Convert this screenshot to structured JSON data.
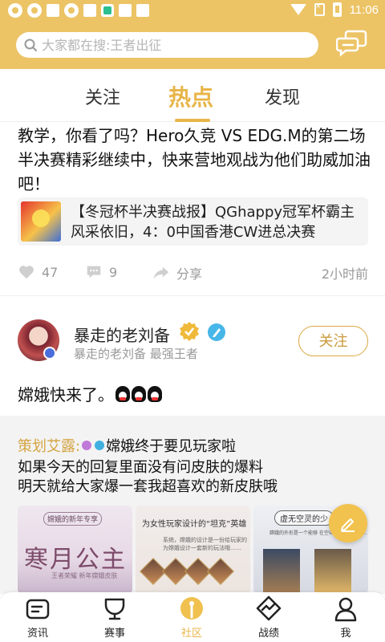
{
  "status_bar": {
    "time": "11:06"
  },
  "search": {
    "placeholder": "大家都在搜:王者出征"
  },
  "tabs": [
    {
      "label": "关注"
    },
    {
      "label": "热点",
      "selected": true
    },
    {
      "label": "发现"
    }
  ],
  "post1": {
    "text": "教学，你看了吗？Hero久竞 VS EDG.M的第二场半决赛精彩继续中，快来营地观战为他们助威加油吧！",
    "link_card": {
      "title": "【冬冠杯半决赛战报】QGhappy冠军杯霸主风采依旧，4：0中国香港CW进总决赛"
    },
    "likes": "47",
    "comments": "9",
    "share_label": "分享",
    "time": "2小时前"
  },
  "post2": {
    "username": "暴走的老刘备",
    "subtitle": "暴走的老刘备  最强王者",
    "follow_label": "关注",
    "text": "嫦娥快来了。",
    "quote": {
      "author": "策划艾露:",
      "line1": "嫦娥终于要见玩家啦",
      "line2": "如果今天的回复里面没有问皮肤的爆料",
      "line3": "明天就给大家爆一套我超喜欢的新皮肤哦"
    },
    "images": [
      {
        "badge": "嫦娥的新年专享",
        "title": "寒月公主",
        "sub": "王者荣耀 新年嫦娥皮肤"
      },
      {
        "head": "为女性玩家设计的“坦克”英雄",
        "body": "系统，嫦娥的设计是一份给玩家的\n为嫦娥设计一套新的玩法哦……"
      },
      {
        "head": "虚无空灵的少",
        "body": "嫦娥的外形是一个能够\n在空中漂浮的角色……"
      }
    ]
  },
  "bottom_nav": [
    {
      "label": "资讯",
      "icon": "news-icon"
    },
    {
      "label": "赛事",
      "icon": "trophy-icon"
    },
    {
      "label": "社区",
      "icon": "community-icon",
      "selected": true
    },
    {
      "label": "战绩",
      "icon": "stats-icon"
    },
    {
      "label": "我",
      "icon": "profile-icon"
    }
  ],
  "colors": {
    "accent": "#e8b548",
    "header": "#ecc466"
  }
}
